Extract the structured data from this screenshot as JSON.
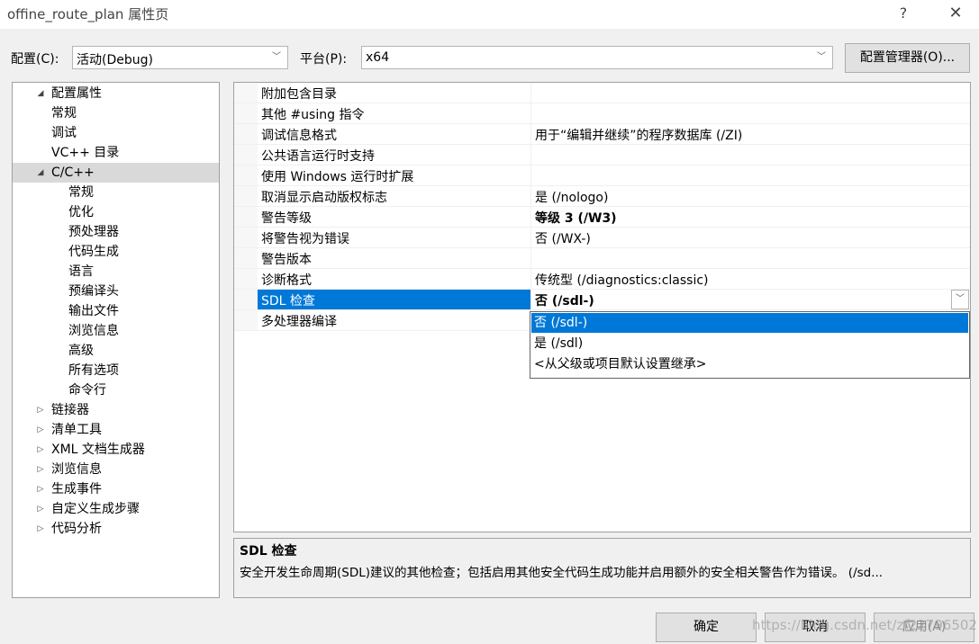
{
  "window": {
    "title": "offine_route_plan 属性页",
    "help_glyph": "?",
    "close_glyph": "✕"
  },
  "config_row": {
    "config_label": "配置(C):",
    "config_value": "活动(Debug)",
    "platform_label": "平台(P):",
    "platform_value": "x64",
    "manager_button": "配置管理器(O)..."
  },
  "tree": {
    "items": [
      {
        "label": "配置属性",
        "toggle": "◢"
      },
      {
        "label": "常规",
        "toggle": ""
      },
      {
        "label": "调试",
        "toggle": ""
      },
      {
        "label": "VC++ 目录",
        "toggle": ""
      },
      {
        "label": "C/C++",
        "toggle": "◢"
      },
      {
        "label": "常规",
        "toggle": ""
      },
      {
        "label": "优化",
        "toggle": ""
      },
      {
        "label": "预处理器",
        "toggle": ""
      },
      {
        "label": "代码生成",
        "toggle": ""
      },
      {
        "label": "语言",
        "toggle": ""
      },
      {
        "label": "预编译头",
        "toggle": ""
      },
      {
        "label": "输出文件",
        "toggle": ""
      },
      {
        "label": "浏览信息",
        "toggle": ""
      },
      {
        "label": "高级",
        "toggle": ""
      },
      {
        "label": "所有选项",
        "toggle": ""
      },
      {
        "label": "命令行",
        "toggle": ""
      },
      {
        "label": "链接器",
        "toggle": "▷"
      },
      {
        "label": "清单工具",
        "toggle": "▷"
      },
      {
        "label": "XML 文档生成器",
        "toggle": "▷"
      },
      {
        "label": "浏览信息",
        "toggle": "▷"
      },
      {
        "label": "生成事件",
        "toggle": "▷"
      },
      {
        "label": "自定义生成步骤",
        "toggle": "▷"
      },
      {
        "label": "代码分析",
        "toggle": "▷"
      }
    ]
  },
  "grid": {
    "rows": [
      {
        "name": "附加包含目录",
        "value": ""
      },
      {
        "name": "其他 #using 指令",
        "value": ""
      },
      {
        "name": "调试信息格式",
        "value": "用于“编辑并继续”的程序数据库 (/ZI)"
      },
      {
        "name": "公共语言运行时支持",
        "value": ""
      },
      {
        "name": "使用 Windows 运行时扩展",
        "value": ""
      },
      {
        "name": "取消显示启动版权标志",
        "value": "是 (/nologo)"
      },
      {
        "name": "警告等级",
        "value": "等级 3 (/W3)"
      },
      {
        "name": "将警告视为错误",
        "value": "否 (/WX-)"
      },
      {
        "name": "警告版本",
        "value": ""
      },
      {
        "name": "诊断格式",
        "value": "传统型 (/diagnostics:classic)"
      },
      {
        "name": "SDL 检查",
        "value": "否 (/sdl-)"
      },
      {
        "name": "多处理器编译",
        "value": ""
      }
    ]
  },
  "dropdown": {
    "options": [
      "否 (/sdl-)",
      "是 (/sdl)",
      "<从父级或项目默认设置继承>"
    ]
  },
  "description": {
    "title": "SDL 检查",
    "text": "安全开发生命周期(SDL)建议的其他检查；包括启用其他安全代码生成功能并启用额外的安全相关警告作为错误。     (/sd..."
  },
  "buttons": {
    "ok": "确定",
    "cancel": "取消",
    "apply": "应用(A)"
  },
  "watermark": "https://blog.csdn.net/zf22796502"
}
